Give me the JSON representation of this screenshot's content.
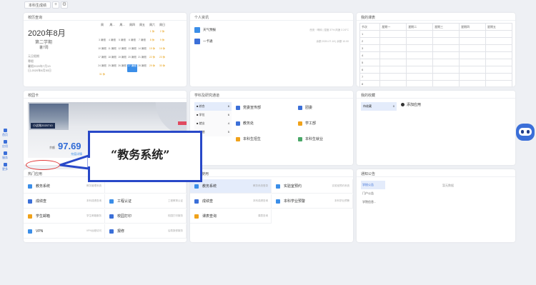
{
  "topbar": {
    "tab_label": "本科生成绩",
    "add_icon": "+",
    "settings_icon": "⚙"
  },
  "calendar": {
    "title": "校历查询",
    "month": "2020年8月",
    "term": "第二学期",
    "week": "暑7周",
    "info1": "元旦假期",
    "info2": "寒假",
    "info3": "暑假2020年7月13",
    "info4": "日-2020年8月30日",
    "weekdays": [
      "周",
      "周...",
      "周...",
      "周四",
      "周五",
      "周六",
      "周日"
    ],
    "cells": [
      "",
      "",
      "",
      "",
      "",
      "1 休",
      "2 休",
      "3 暑假",
      "4 暑假",
      "5 暑假",
      "6 暑假",
      "7 暑假",
      "8 休",
      "9 休",
      "10 暑假",
      "11 暑假",
      "12 暑假",
      "13 暑假",
      "14 暑假",
      "15 休",
      "16 休",
      "17 暑假",
      "18 暑假",
      "19 暑假",
      "20 暑假",
      "21 暑假",
      "22 休",
      "23 休",
      "24 暑假",
      "25 暑假",
      "26 暑假",
      "27 暑假",
      "28 暑假",
      "29 休",
      "30 休",
      "31 休",
      "",
      "",
      "",
      "",
      "",
      ""
    ]
  },
  "personal": {
    "title": "个人资讯",
    "rows": [
      {
        "label": "天气预报",
        "info": "西安 · 晴转 | 湿度 37% 风速 3 24°C"
      },
      {
        "label": "一卡通",
        "info": "余额 2020-07-18 | 余额 10.00"
      }
    ]
  },
  "schedule": {
    "title": "我的课表",
    "headers": [
      "节次",
      "星期一",
      "星期二",
      "星期三",
      "星期四",
      "星期五"
    ],
    "rows": [
      "1",
      "2",
      "3",
      "4",
      "5",
      "6",
      "7",
      "8"
    ]
  },
  "campus": {
    "title": "校园卡",
    "photo_label": "小这账2020710",
    "score_label": "余额",
    "score": "97.69",
    "unit": "元",
    "link": "充值详情"
  },
  "dept": {
    "title": "学科及研究通道",
    "list": [
      {
        "name": "综合",
        "count": "6"
      },
      {
        "name": "学位",
        "count": "6"
      },
      {
        "name": "就业",
        "count": "4"
      },
      {
        "name": "其他",
        "count": "5"
      }
    ],
    "items": [
      "党委宣传部",
      "团委",
      "教务处",
      "学工部",
      "本科生招生",
      "本科生就业"
    ]
  },
  "favorites": {
    "title": "我的收藏",
    "tag": "待收藏",
    "tag_count": "0",
    "add_label": "添加应用"
  },
  "hot_apps": {
    "title": "热门应用",
    "items": [
      {
        "label": "教务系统",
        "desc": "教务管理系统"
      },
      {
        "label": "",
        "desc": ""
      },
      {
        "label": "成绩查",
        "desc": "本科成绩查询"
      },
      {
        "label": "工程认证",
        "desc": "工程教育认证"
      },
      {
        "label": "学生邮箱",
        "desc": "学生邮箱服务"
      },
      {
        "label": "校园打印",
        "desc": "校园打印服务"
      },
      {
        "label": "VPN",
        "desc": "VPN远程访问"
      },
      {
        "label": "报修",
        "desc": "后勤报修服务"
      }
    ]
  },
  "recent_apps": {
    "title": "最近使用",
    "items": [
      {
        "label": "教务系统",
        "desc": "教务系统登录"
      },
      {
        "label": "实验室预约",
        "desc": "实验室预约系统"
      },
      {
        "label": "成绩查",
        "desc": "本科成绩查询"
      },
      {
        "label": "本科学业预警",
        "desc": "本科学业预警"
      },
      {
        "label": "课表查询",
        "desc": "课表查询"
      }
    ]
  },
  "notices": {
    "title": "通知公告",
    "tabs": [
      "学校公告",
      "门户公告",
      "学院信息..."
    ],
    "empty_text": "暂无数据"
  },
  "sidebar": {
    "items": [
      "首页",
      "应用",
      "服务",
      "更多"
    ]
  },
  "callout": {
    "text": "“教务系统”"
  },
  "colors": {
    "accent": "#3b6fd8",
    "callout_border": "#2848c8",
    "highlight_circle": "#e23b3b"
  }
}
